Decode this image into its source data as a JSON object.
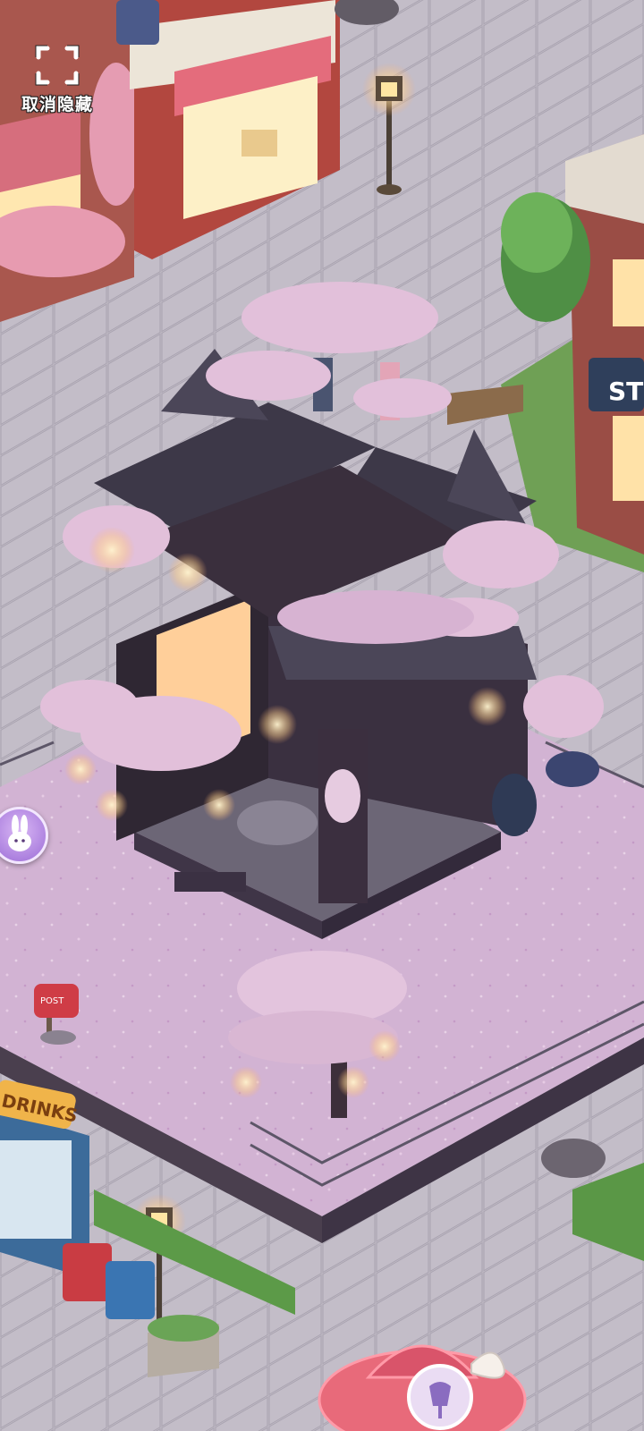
{
  "hud": {
    "unhide_label": "取消隐藏",
    "unhide_icon": "fullscreen-brackets-icon"
  },
  "scene": {
    "drinks_sign": "DRINKS",
    "post_sign": "POST",
    "shop_sign_partial": "ST",
    "accent_colors": {
      "blossom": "#e8c4dc",
      "plaza": "#d4b6d4",
      "lantern_glow": "#ffd9a0",
      "pavilion_roof": "#4b4658"
    }
  },
  "side_buttons": {
    "left_icon": "bunny-icon",
    "bottom_icon": "dress-form-icon"
  }
}
